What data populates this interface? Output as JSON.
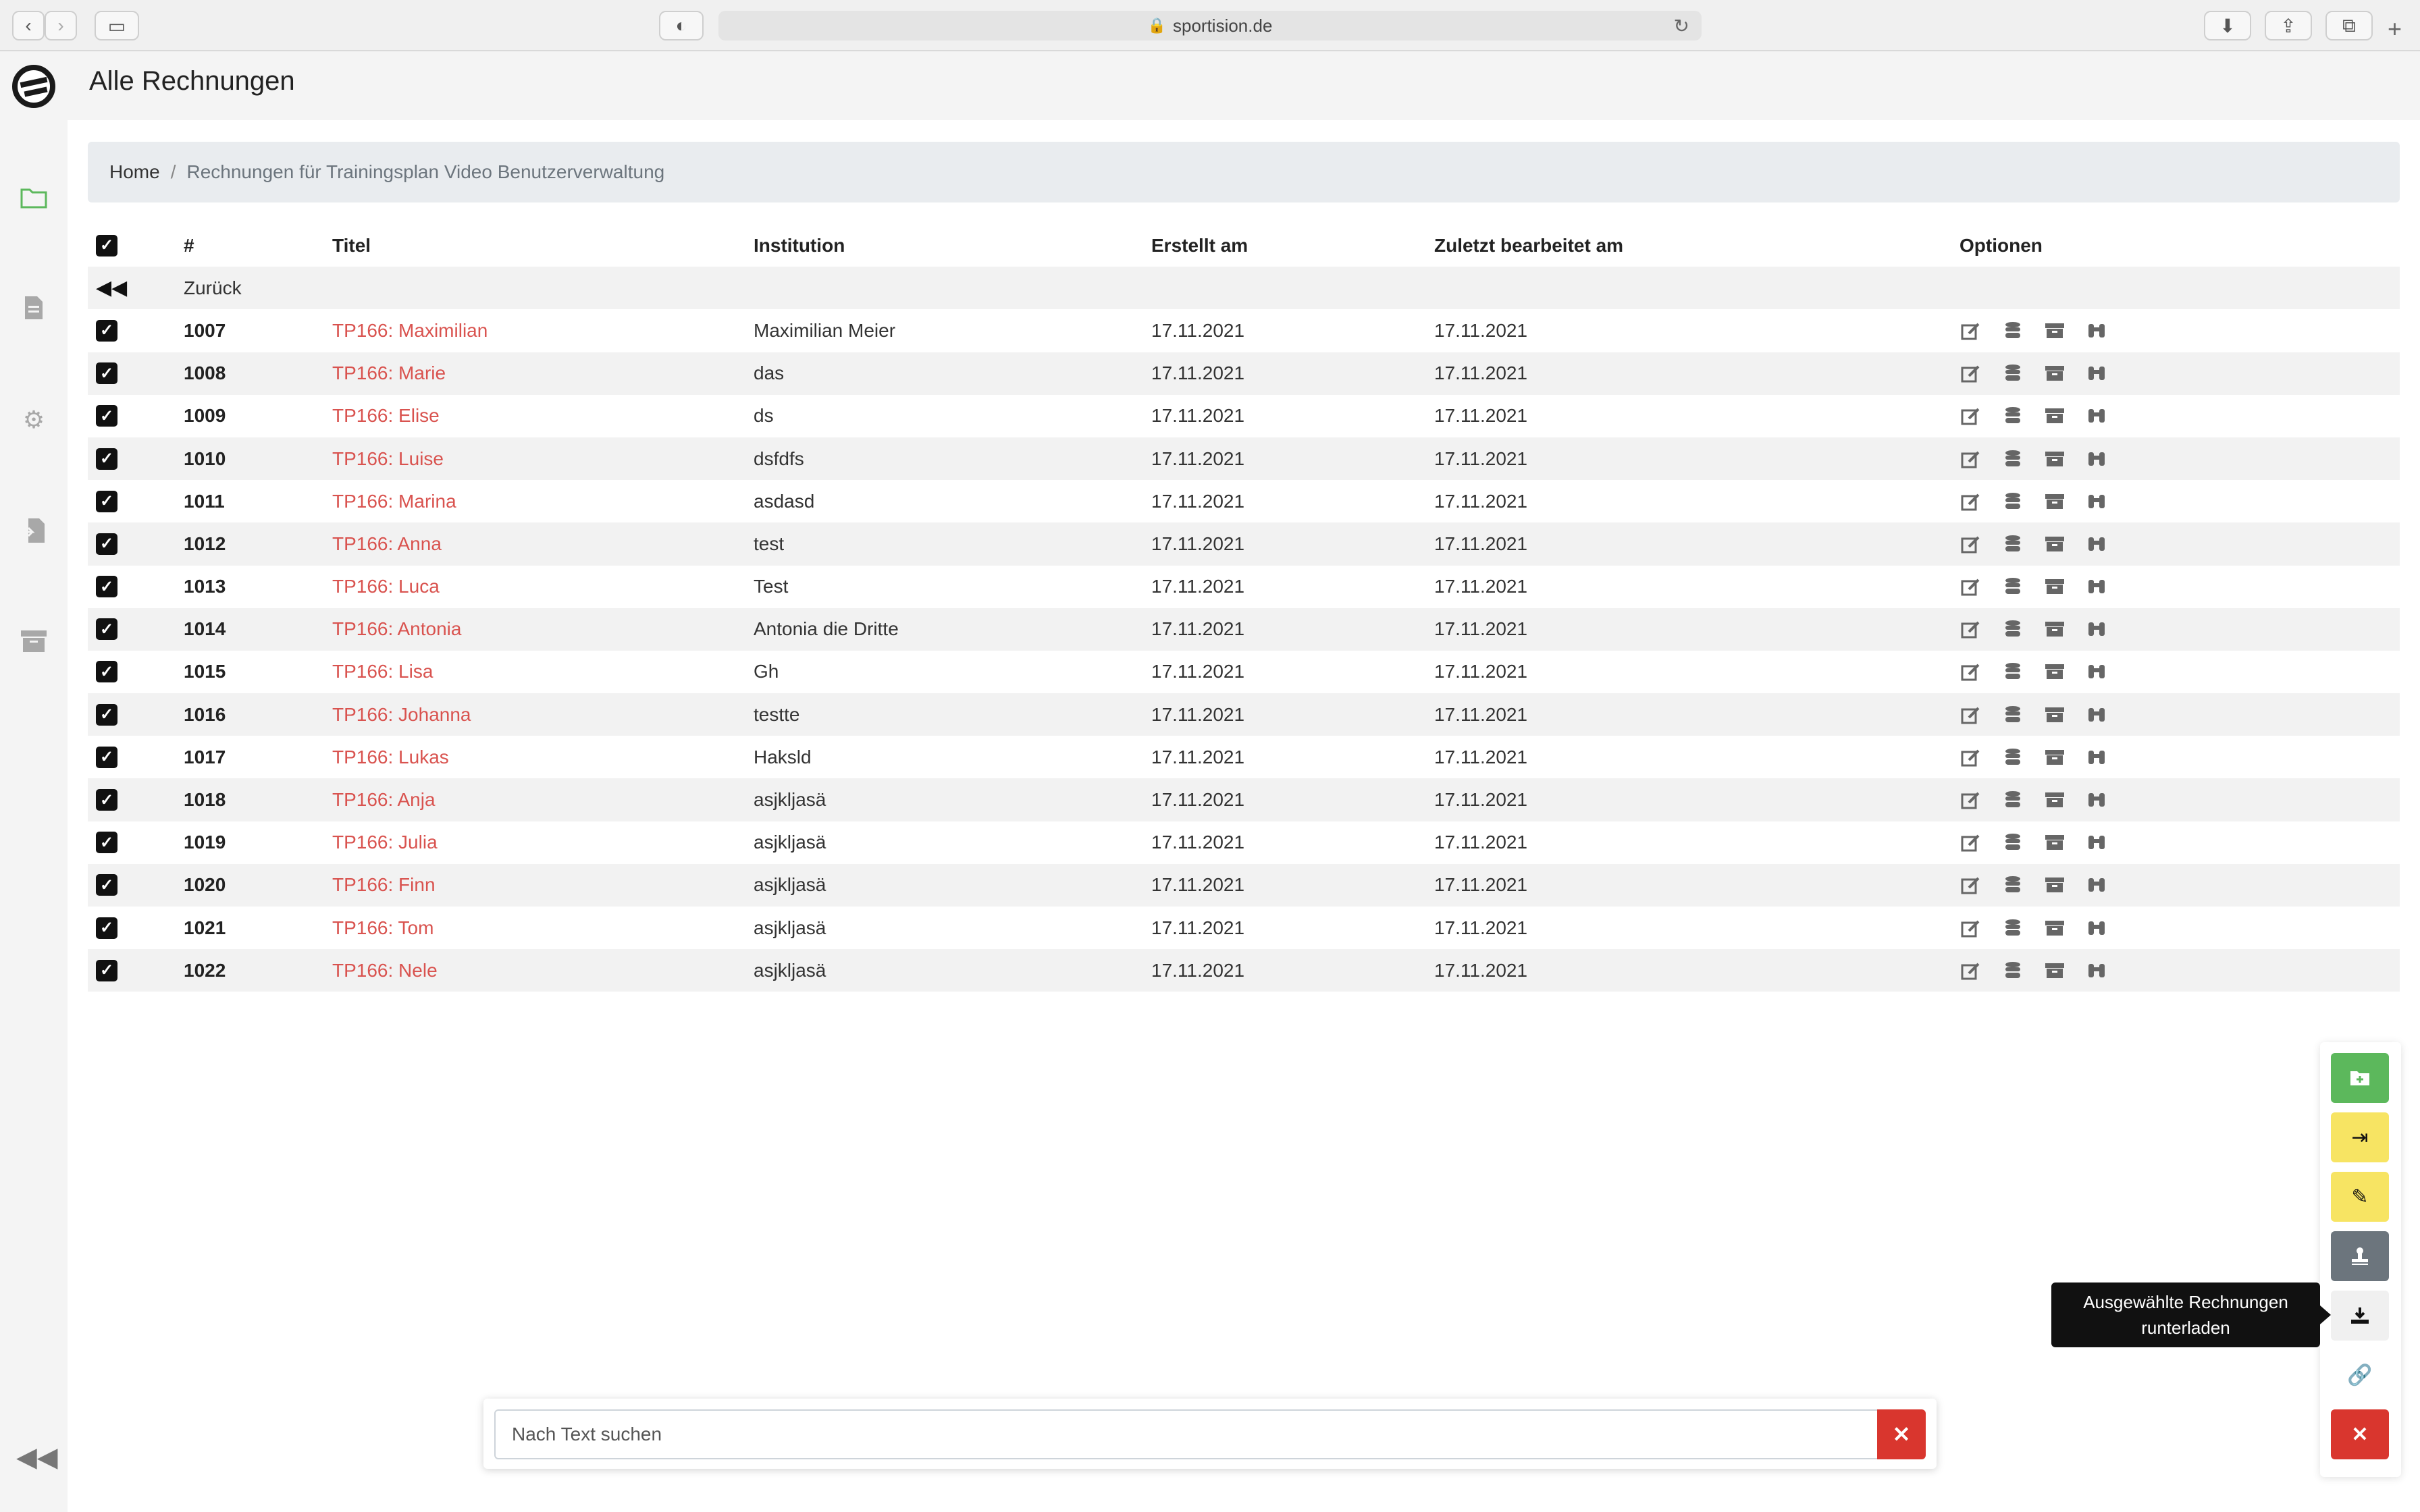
{
  "browser": {
    "url": "sportision.de"
  },
  "header": {
    "title": "Alle Rechnungen"
  },
  "breadcrumb": {
    "home": "Home",
    "separator": "/",
    "current": "Rechnungen für Trainingsplan Video Benutzerverwaltung"
  },
  "table": {
    "columns": {
      "number": "#",
      "title": "Titel",
      "institution": "Institution",
      "created": "Erstellt am",
      "edited": "Zuletzt bearbeitet am",
      "options": "Optionen"
    },
    "back_label": "Zurück",
    "rows": [
      {
        "number": "1007",
        "title": "TP166: Maximilian",
        "institution": "Maximilian Meier",
        "created": "17.11.2021",
        "edited": "17.11.2021"
      },
      {
        "number": "1008",
        "title": "TP166: Marie",
        "institution": "das",
        "created": "17.11.2021",
        "edited": "17.11.2021"
      },
      {
        "number": "1009",
        "title": "TP166: Elise",
        "institution": "ds",
        "created": "17.11.2021",
        "edited": "17.11.2021"
      },
      {
        "number": "1010",
        "title": "TP166: Luise",
        "institution": "dsfdfs",
        "created": "17.11.2021",
        "edited": "17.11.2021"
      },
      {
        "number": "1011",
        "title": "TP166: Marina",
        "institution": "asdasd",
        "created": "17.11.2021",
        "edited": "17.11.2021"
      },
      {
        "number": "1012",
        "title": "TP166: Anna",
        "institution": "test",
        "created": "17.11.2021",
        "edited": "17.11.2021"
      },
      {
        "number": "1013",
        "title": "TP166: Luca",
        "institution": "Test",
        "created": "17.11.2021",
        "edited": "17.11.2021"
      },
      {
        "number": "1014",
        "title": "TP166: Antonia",
        "institution": "Antonia die Dritte",
        "created": "17.11.2021",
        "edited": "17.11.2021"
      },
      {
        "number": "1015",
        "title": "TP166: Lisa",
        "institution": "Gh",
        "created": "17.11.2021",
        "edited": "17.11.2021"
      },
      {
        "number": "1016",
        "title": "TP166: Johanna",
        "institution": "testte",
        "created": "17.11.2021",
        "edited": "17.11.2021"
      },
      {
        "number": "1017",
        "title": "TP166: Lukas",
        "institution": "Haksld",
        "created": "17.11.2021",
        "edited": "17.11.2021"
      },
      {
        "number": "1018",
        "title": "TP166: Anja",
        "institution": "asjkljasä",
        "created": "17.11.2021",
        "edited": "17.11.2021"
      },
      {
        "number": "1019",
        "title": "TP166: Julia",
        "institution": "asjkljasä",
        "created": "17.11.2021",
        "edited": "17.11.2021"
      },
      {
        "number": "1020",
        "title": "TP166: Finn",
        "institution": "asjkljasä",
        "created": "17.11.2021",
        "edited": "17.11.2021"
      },
      {
        "number": "1021",
        "title": "TP166: Tom",
        "institution": "asjkljasä",
        "created": "17.11.2021",
        "edited": "17.11.2021"
      },
      {
        "number": "1022",
        "title": "TP166: Nele",
        "institution": "asjkljasä",
        "created": "17.11.2021",
        "edited": "17.11.2021"
      }
    ]
  },
  "search": {
    "placeholder": "Nach Text suchen"
  },
  "tooltip": {
    "line1": "Ausgewählte Rechnungen",
    "line2": "runterladen"
  },
  "colors": {
    "accent_red": "#d9534f",
    "green": "#5cb85c",
    "yellow": "#f7e463",
    "gray": "#6c757d",
    "danger": "#d9362e"
  }
}
